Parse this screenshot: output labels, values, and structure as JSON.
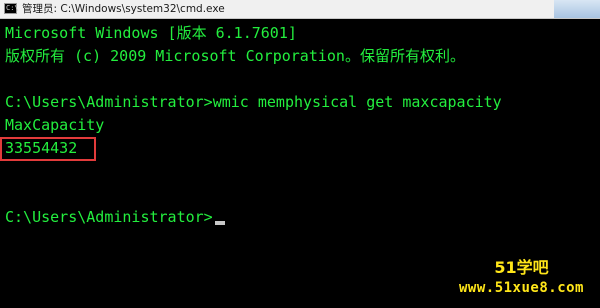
{
  "window": {
    "title": "管理员: C:\\Windows\\system32\\cmd.exe",
    "icon": "cmd-console-icon",
    "icon_glyph": "C:\\"
  },
  "console": {
    "lines": [
      "Microsoft Windows [版本 6.1.7601]",
      "版权所有 (c) 2009 Microsoft Corporation。保留所有权利。",
      "",
      "C:\\Users\\Administrator>wmic memphysical get maxcapacity",
      "MaxCapacity",
      "33554432",
      "",
      "",
      "C:\\Users\\Administrator>"
    ],
    "text_color": "#23ee3e",
    "background_color": "#000000"
  },
  "highlight": {
    "color": "#e23b3b"
  },
  "watermark": {
    "brand": "51学吧",
    "url": "www.51xue8.com",
    "color": "#ffe619"
  }
}
